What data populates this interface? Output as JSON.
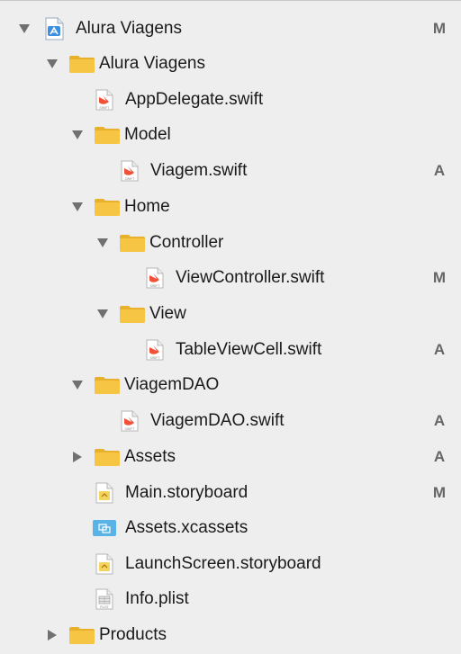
{
  "colors": {
    "folder": "#f6c544",
    "folder_tab": "#e9b02c",
    "swift": "#f05138",
    "assets": "#5ab3e6",
    "status": "#666666"
  },
  "tree": {
    "project": {
      "label": "Alura Viagens",
      "status": "M",
      "icon": "xcode-project-icon"
    },
    "group_root": {
      "label": "Alura Viagens",
      "icon": "folder-icon"
    },
    "app_delegate": {
      "label": "AppDelegate.swift",
      "icon": "swift-file-icon",
      "badge": "SWIFT"
    },
    "model": {
      "label": "Model",
      "icon": "folder-icon"
    },
    "viagem_swift": {
      "label": "Viagem.swift",
      "status": "A",
      "icon": "swift-file-icon",
      "badge": "SWIFT"
    },
    "home": {
      "label": "Home",
      "icon": "folder-icon"
    },
    "controller": {
      "label": "Controller",
      "icon": "folder-icon"
    },
    "view_controller": {
      "label": "ViewController.swift",
      "status": "M",
      "icon": "swift-file-icon",
      "badge": "SWIFT"
    },
    "view": {
      "label": "View",
      "icon": "folder-icon"
    },
    "table_view_cell": {
      "label": "TableViewCell.swift",
      "status": "A",
      "icon": "swift-file-icon",
      "badge": "SWIFT"
    },
    "viagem_dao": {
      "label": "ViagemDAO",
      "icon": "folder-icon"
    },
    "viagem_dao_swift": {
      "label": "ViagemDAO.swift",
      "status": "A",
      "icon": "swift-file-icon",
      "badge": "SWIFT"
    },
    "assets": {
      "label": "Assets",
      "status": "A",
      "icon": "folder-icon"
    },
    "main_storyboard": {
      "label": "Main.storyboard",
      "status": "M",
      "icon": "storyboard-file-icon"
    },
    "assets_xcassets": {
      "label": "Assets.xcassets",
      "icon": "asset-catalog-icon"
    },
    "launch_storyboard": {
      "label": "LaunchScreen.storyboard",
      "icon": "storyboard-file-icon"
    },
    "info_plist": {
      "label": "Info.plist",
      "icon": "plist-file-icon",
      "badge": "PLIST"
    },
    "products": {
      "label": "Products",
      "icon": "folder-icon"
    }
  }
}
